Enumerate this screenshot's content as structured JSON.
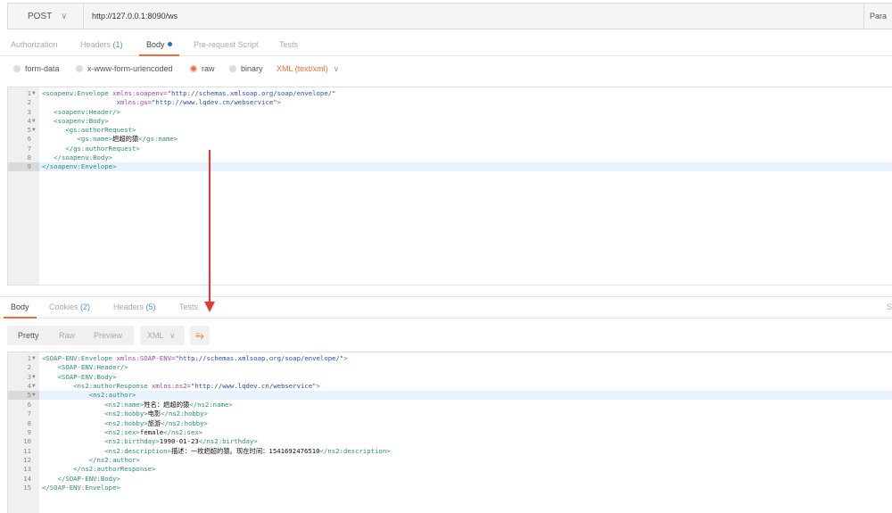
{
  "request": {
    "method": "POST",
    "url": "http://127.0.0.1:8090/ws",
    "params_label": "Para",
    "tabs": [
      {
        "label": "Authorization"
      },
      {
        "label": "Headers",
        "count": "(1)"
      },
      {
        "label": "Body"
      },
      {
        "label": "Pre-request Script"
      },
      {
        "label": "Tests"
      }
    ],
    "body_modes": [
      "form-data",
      "x-www-form-urlencoded",
      "raw",
      "binary"
    ],
    "content_type": "XML (text/xml)",
    "lines": [
      [
        [
          "t",
          "<soapenv:Envelope "
        ],
        [
          "a",
          "xmlns:soapenv="
        ],
        [
          "v",
          "\"http://schemas.xmlsoap.org/soap/envelope/\""
        ]
      ],
      [
        [
          "x",
          "                   "
        ],
        [
          "a",
          "xmlns:gs="
        ],
        [
          "v",
          "\"http://www.lqdev.cn/webservice\""
        ],
        [
          "t",
          ">"
        ]
      ],
      [
        [
          "t",
          "   <soapenv:Header/>"
        ]
      ],
      [
        [
          "t",
          "   <soapenv:Body>"
        ]
      ],
      [
        [
          "t",
          "      <gs:authorRequest>"
        ]
      ],
      [
        [
          "t",
          "         <gs:name>"
        ],
        [
          "x",
          "趔超的猿"
        ],
        [
          "t",
          "</gs:name>"
        ]
      ],
      [
        [
          "t",
          "      </gs:authorRequest>"
        ]
      ],
      [
        [
          "t",
          "   </soapenv:Body>"
        ]
      ],
      [
        [
          "t",
          "</soapenv:Envelope>"
        ]
      ]
    ],
    "folds": [
      1,
      4,
      5
    ]
  },
  "response": {
    "tabs": [
      {
        "label": "Body"
      },
      {
        "label": "Cookies",
        "count": "(2)"
      },
      {
        "label": "Headers",
        "count": "(5)"
      },
      {
        "label": "Tests"
      }
    ],
    "right_label": "S",
    "views": [
      "Pretty",
      "Raw",
      "Preview"
    ],
    "format": "XML",
    "lines": [
      [
        [
          "t",
          "<SOAP-ENV:Envelope "
        ],
        [
          "a",
          "xmlns:SOAP-ENV="
        ],
        [
          "v",
          "\"http://schemas.xmlsoap.org/soap/envelope/\""
        ],
        [
          "t",
          ">"
        ]
      ],
      [
        [
          "t",
          "    <SOAP-ENV:Header/>"
        ]
      ],
      [
        [
          "t",
          "    <SOAP-ENV:Body>"
        ]
      ],
      [
        [
          "t",
          "        <ns2:authorResponse "
        ],
        [
          "a",
          "xmlns:ns2="
        ],
        [
          "v",
          "\"http://www.lqdev.cn/webservice\""
        ],
        [
          "t",
          ">"
        ]
      ],
      [
        [
          "t",
          "            <ns2:author>"
        ]
      ],
      [
        [
          "t",
          "                <ns2:name>"
        ],
        [
          "x",
          "姓名：趔超的猿"
        ],
        [
          "t",
          "</ns2:name>"
        ]
      ],
      [
        [
          "t",
          "                <ns2:hobby>"
        ],
        [
          "x",
          "电影"
        ],
        [
          "t",
          "</ns2:hobby>"
        ]
      ],
      [
        [
          "t",
          "                <ns2:hobby>"
        ],
        [
          "x",
          "旅游"
        ],
        [
          "t",
          "</ns2:hobby>"
        ]
      ],
      [
        [
          "t",
          "                <ns2:sex>"
        ],
        [
          "x",
          "female"
        ],
        [
          "t",
          "</ns2:sex>"
        ]
      ],
      [
        [
          "t",
          "                <ns2:birthday>"
        ],
        [
          "x",
          "1990-01-23"
        ],
        [
          "t",
          "</ns2:birthday>"
        ]
      ],
      [
        [
          "t",
          "                <ns2:description>"
        ],
        [
          "x",
          "描述：一枚趔超的猿。现在时间：1541692476510"
        ],
        [
          "t",
          "</ns2:description>"
        ]
      ],
      [
        [
          "t",
          "            </ns2:author>"
        ]
      ],
      [
        [
          "t",
          "        </ns2:authorResponse>"
        ]
      ],
      [
        [
          "t",
          "    </SOAP-ENV:Body>"
        ]
      ],
      [
        [
          "t",
          "</SOAP-ENV:Envelope>"
        ]
      ]
    ],
    "folds": [
      1,
      3,
      4,
      5
    ]
  }
}
